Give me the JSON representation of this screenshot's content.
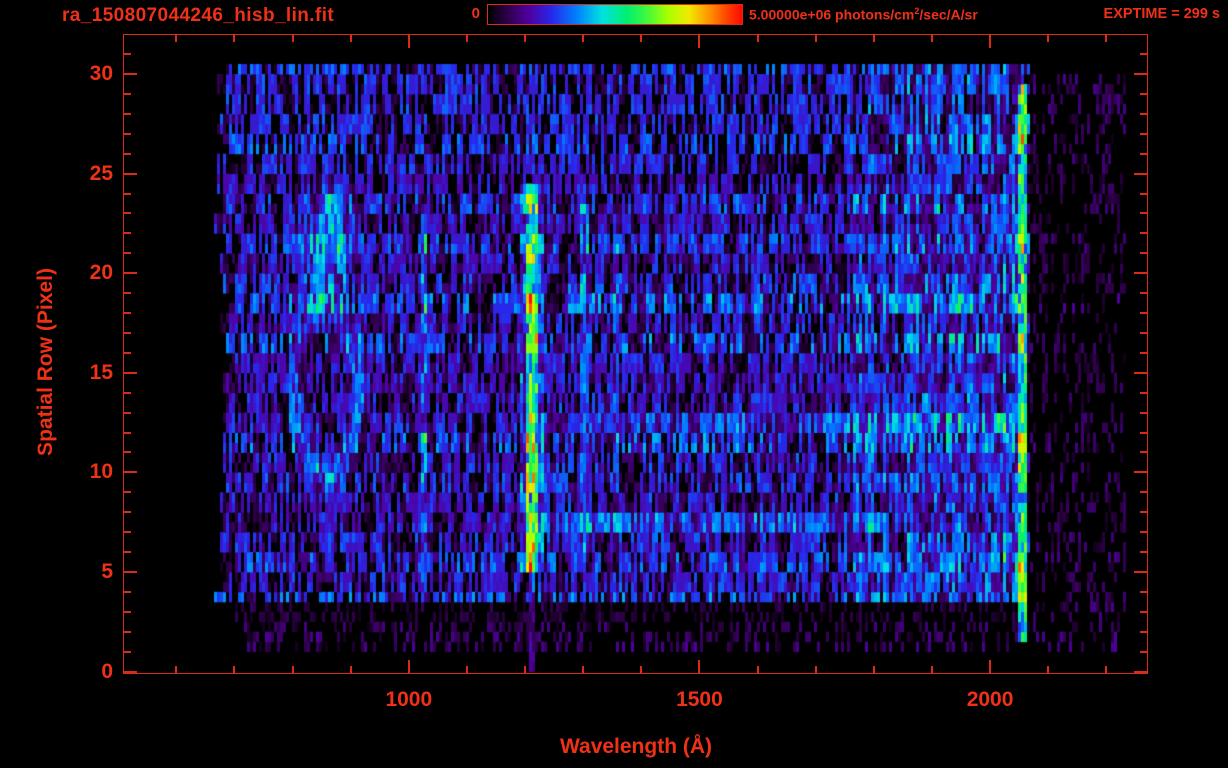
{
  "window": {
    "background": "#000000"
  },
  "header": {
    "filename": "ra_150807044246_hisb_lin.fit",
    "exptime": "EXPTIME = 299 s",
    "colorbar": {
      "min_label": "0",
      "max_value": "5.00000e+06",
      "units_pre": " photons/cm",
      "units_sup": "2",
      "units_post": "/sec/A/sr"
    }
  },
  "axes": {
    "x": {
      "label": "Wavelength (Å)",
      "min": 510,
      "max": 2270,
      "major_ticks": [
        1000,
        1500,
        2000
      ],
      "minor_step": 100
    },
    "y": {
      "label": "Spatial Row (Pixel)",
      "min": 0,
      "max": 32,
      "major_ticks": [
        0,
        5,
        10,
        15,
        20,
        25,
        30
      ],
      "minor_step": 1
    }
  },
  "colors": {
    "text": "#ef3118",
    "axis": "#d92b15",
    "background": "#000000",
    "colormap": [
      [
        0.0,
        [
          0,
          0,
          0
        ]
      ],
      [
        0.07,
        [
          45,
          0,
          70
        ]
      ],
      [
        0.16,
        [
          80,
          0,
          160
        ]
      ],
      [
        0.25,
        [
          40,
          40,
          235
        ]
      ],
      [
        0.35,
        [
          0,
          130,
          255
        ]
      ],
      [
        0.45,
        [
          0,
          225,
          225
        ]
      ],
      [
        0.55,
        [
          0,
          240,
          110
        ]
      ],
      [
        0.63,
        [
          70,
          250,
          60
        ]
      ],
      [
        0.71,
        [
          170,
          255,
          0
        ]
      ],
      [
        0.79,
        [
          240,
          235,
          0
        ]
      ],
      [
        0.87,
        [
          255,
          150,
          0
        ]
      ],
      [
        0.94,
        [
          255,
          70,
          0
        ]
      ],
      [
        1.0,
        [
          255,
          10,
          0
        ]
      ]
    ]
  },
  "chart_data": {
    "type": "heatmap",
    "title": "ra_150807044246_hisb_lin.fit",
    "xlabel": "Wavelength (Å)",
    "ylabel": "Spatial Row (Pixel)",
    "xlim": [
      510,
      2270
    ],
    "ylim": [
      0,
      32
    ],
    "grid": false,
    "colorbar": {
      "min": 0,
      "max": 5000000,
      "units": "photons/cm^2/sec/A/sr",
      "palette": "rainbow",
      "position": "top"
    },
    "exposure_time_s": 299,
    "data_extent": {
      "wavelength": [
        690,
        2066
      ],
      "rows": [
        0,
        30.5
      ]
    },
    "features": [
      {
        "kind": "noise",
        "note": "dim purple-blue background noise, rows 24.5-30.5",
        "wl": [
          690,
          2066
        ],
        "rows": [
          24.5,
          30.45
        ],
        "density": 0.88,
        "level": 0.115,
        "jitter": 0.1,
        "spike": 0.012
      },
      {
        "kind": "noise",
        "note": "main blue detector background, rows 3.4-24.5",
        "wl": [
          690,
          2066
        ],
        "rows": [
          3.4,
          24.5
        ],
        "density": 0.93,
        "level": 0.16,
        "jitter": 0.12,
        "spike": 0.015
      },
      {
        "kind": "noise",
        "note": "sparse noise band rows 2.6-3.4",
        "wl": [
          700,
          2056
        ],
        "rows": [
          2.6,
          3.4
        ],
        "density": 0.38,
        "level": 0.11,
        "jitter": 0.09
      },
      {
        "kind": "noise",
        "note": "very sparse spikes rows 1-2.6",
        "wl": [
          710,
          2050
        ],
        "rows": [
          1.0,
          2.6
        ],
        "density": 0.1,
        "level": 0.16,
        "jitter": 0.12
      },
      {
        "kind": "noise",
        "note": "stray counts beyond long-wavelength edge",
        "wl": [
          2066,
          2232
        ],
        "rows": [
          1,
          30
        ],
        "density": 0.05,
        "level": 0.16,
        "jitter": 0.12
      },
      {
        "kind": "band",
        "note": "faint FUV continuum 1230-1760, rows 4-24",
        "wl": [
          1232,
          1764
        ],
        "rows": [
          3.6,
          24.4
        ],
        "level": 0.06
      },
      {
        "kind": "band",
        "note": "bright green continuum 1760-2046, rows 4-24",
        "wl": [
          1764,
          2046
        ],
        "rows": [
          3.6,
          24.4
        ],
        "level": 0.24
      },
      {
        "kind": "band",
        "note": "green continuum bleed above row 24",
        "wl": [
          1790,
          2046
        ],
        "rows": [
          24.4,
          30.4
        ],
        "level": 0.17
      },
      {
        "kind": "band",
        "note": "brightening just before detector edge",
        "wl": [
          2012,
          2046
        ],
        "rows": [
          3.5,
          29.0
        ],
        "level": 0.12
      },
      {
        "kind": "ring",
        "note": "ring-shaped emission feature near 860 Å, rows 10-18.5",
        "center": [
          858,
          14.2
        ],
        "radius": [
          55,
          4.3
        ],
        "width": 0.3,
        "level": 0.3
      },
      {
        "kind": "blob",
        "note": "bright green knot near 860 Å, rows 19.5-23",
        "center": [
          862,
          21.4
        ],
        "size": [
          42,
          1.9
        ],
        "level": 0.48
      },
      {
        "kind": "blob",
        "note": "cap of knot at row 23.7",
        "center": [
          864,
          23.7
        ],
        "size": [
          20,
          0.85
        ],
        "level": 0.3
      },
      {
        "kind": "vline",
        "note": "Lyman-beta / O I 1027 airglow line",
        "wl": [
          1022,
          1033
        ],
        "rows": [
          4.6,
          23.6
        ],
        "level": 0.3
      },
      {
        "kind": "vline",
        "note": "Lyman-alpha halo",
        "wl": [
          1192,
          1231
        ],
        "rows": [
          4.8,
          24.3
        ],
        "level": 0.27
      },
      {
        "kind": "vline",
        "note": "Lyman-alpha core",
        "wl": [
          1200,
          1223
        ],
        "rows": [
          4.8,
          24.3
        ],
        "level": 0.42
      },
      {
        "kind": "vline",
        "note": "Lyman-alpha hot section rows 5-10",
        "wl": [
          1202,
          1219
        ],
        "rows": [
          5.2,
          10.3
        ],
        "level": 0.2
      },
      {
        "kind": "vline",
        "note": "Lyman-alpha mid section",
        "wl": [
          1202,
          1219
        ],
        "rows": [
          10.3,
          17.3
        ],
        "level": 0.08
      },
      {
        "kind": "vline",
        "note": "Lyman-alpha hot section rows 17-22",
        "wl": [
          1202,
          1219
        ],
        "rows": [
          17.3,
          22.0
        ],
        "level": 0.2
      },
      {
        "kind": "vline",
        "note": "Lyman-alpha bleed below slit to row 0",
        "wl": [
          1207,
          1215
        ],
        "rows": [
          0,
          4.8
        ],
        "level": 0.19
      },
      {
        "kind": "vline",
        "note": "O I 1304 airglow line",
        "wl": [
          1297,
          1310
        ],
        "rows": [
          5.8,
          23.5
        ],
        "level": 0.24
      },
      {
        "kind": "vline",
        "note": "faint emission near 1356 Å",
        "wl": [
          1351,
          1361
        ],
        "rows": [
          6,
          23
        ],
        "level": 0.13
      },
      {
        "kind": "hband",
        "note": "bright spatial row 7.4 from Ly-alpha to 1820",
        "wl": [
          1205,
          1824
        ],
        "rows": [
          6.9,
          7.95
        ],
        "level": 0.27
      },
      {
        "kind": "hband",
        "note": "bright spatial row 12.6, brightening to long wavelengths",
        "wl": [
          1240,
          2046
        ],
        "rows": [
          12.05,
          13.1
        ],
        "level": 0.2,
        "ramp": [
          0.1,
          0.38
        ]
      },
      {
        "kind": "vline",
        "note": "detector long-wavelength cutoff (red edge) near 2055 Å",
        "wl": [
          2046,
          2066
        ],
        "rows": [
          1.6,
          29.4
        ],
        "level": 0.72,
        "patchy": 0.72
      }
    ]
  }
}
